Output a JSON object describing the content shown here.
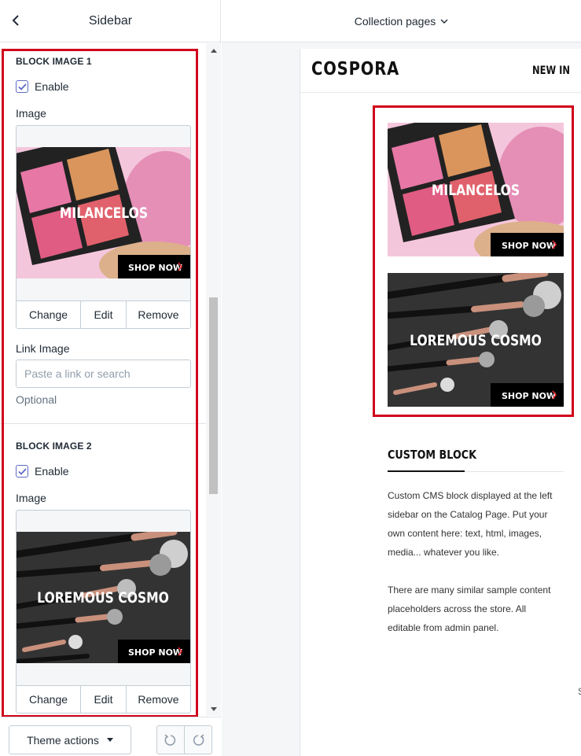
{
  "sidebar": {
    "title": "Sidebar",
    "blocks": [
      {
        "section_title": "BLOCK IMAGE 1",
        "enable_label": "Enable",
        "enabled": true,
        "image_label": "Image",
        "image_text": "MILANCELOS",
        "image_button": "SHOP NOW",
        "change_label": "Change",
        "edit_label": "Edit",
        "remove_label": "Remove",
        "link_label": "Link Image",
        "link_placeholder": "Paste a link or search",
        "help_text": "Optional"
      },
      {
        "section_title": "BLOCK IMAGE 2",
        "enable_label": "Enable",
        "enabled": true,
        "image_label": "Image",
        "image_text": "LOREMOUS COSMO",
        "image_button": "SHOP NOW",
        "change_label": "Change",
        "edit_label": "Edit",
        "remove_label": "Remove"
      }
    ]
  },
  "bottom_bar": {
    "theme_actions_label": "Theme actions",
    "undo_icon": "undo-icon",
    "redo_icon": "redo-icon"
  },
  "top_bar": {
    "page_selector": "Collection pages"
  },
  "store": {
    "logo": "COSPORA",
    "nav_item": "NEW IN",
    "banners": [
      {
        "text": "MILANCELOS",
        "button": "SHOP NOW"
      },
      {
        "text": "LOREMOUS COSMO",
        "button": "SHOP NOW"
      }
    ],
    "cms_block": {
      "title": "CUSTOM BLOCK",
      "lines_p1": [
        "Custom CMS block displayed at the left",
        "sidebar on the Catalog Page. Put your",
        "own content here: text, html, images,",
        "media... whatever you like."
      ],
      "lines_p2": [
        "There are many similar sample content",
        "placeholders across the store. All",
        "editable from admin panel."
      ]
    },
    "edge_char": "S"
  },
  "colors": {
    "highlight": "#d0021b",
    "accent": "#5c6ac4",
    "shop_arrow": "#e8242b"
  }
}
